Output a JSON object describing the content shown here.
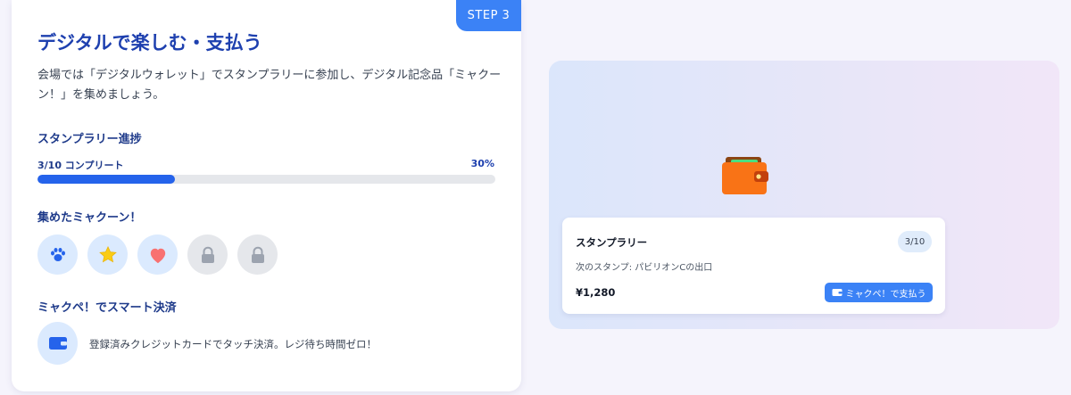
{
  "colors": {
    "primary": "#2563eb",
    "accent": "#3b82f6",
    "title": "#1e40af",
    "stamp_bg": "#dbeafe",
    "locked_bg": "#e5e7eb"
  },
  "card": {
    "step_badge": "STEP 3",
    "title": "デジタルで楽しむ・支払う",
    "description": "会場では「デジタルウォレット」でスタンプラリーに参加し、デジタル記念品「ミャクーン！」を集めましょう。"
  },
  "progress": {
    "heading": "スタンプラリー進捗",
    "label": "3/10 コンプリート",
    "percent_text": "30%",
    "fraction": 0.3
  },
  "collected": {
    "heading": "集めたミャクーン！",
    "stamps": [
      {
        "icon": "paw-icon",
        "state": "collected"
      },
      {
        "icon": "star-icon",
        "state": "collected"
      },
      {
        "icon": "heart-icon",
        "state": "collected"
      },
      {
        "icon": "lock-icon",
        "state": "locked"
      },
      {
        "icon": "lock-icon",
        "state": "locked"
      }
    ]
  },
  "payment": {
    "heading": "ミャクペ！でスマート決済",
    "icon": "wallet-icon",
    "text": "登録済みクレジットカードでタッチ決済。レジ待ち時間ゼロ！"
  },
  "preview": {
    "icon": "wallet-icon",
    "card_title": "スタンプラリー",
    "count": "3/10",
    "next_stamp": "次のスタンプ: パビリオンCの出口",
    "price": "¥1,280",
    "pay_button": "ミャクペ！で支払う"
  }
}
